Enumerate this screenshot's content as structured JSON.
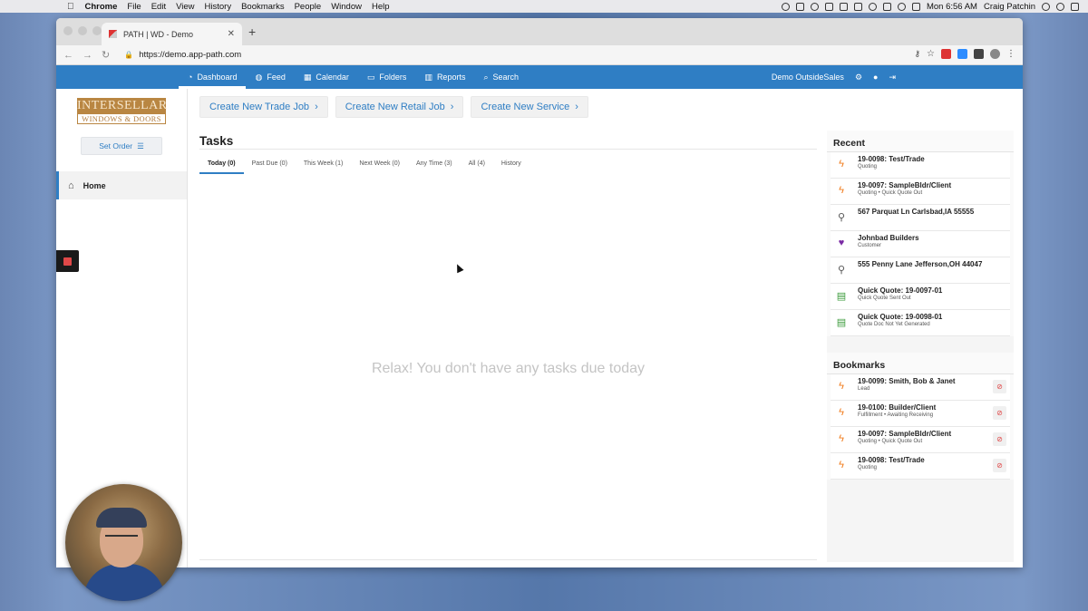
{
  "menubar": {
    "app": "Chrome",
    "items": [
      "File",
      "Edit",
      "View",
      "History",
      "Bookmarks",
      "People",
      "Window",
      "Help"
    ],
    "clock": "Mon 6:56 AM",
    "user": "Craig Patchin"
  },
  "browser": {
    "tab_title": "PATH | WD - Demo",
    "url": "https://demo.app-path.com"
  },
  "appnav": {
    "items": [
      {
        "label": "Dashboard",
        "icon": "dashboard-icon",
        "active": true
      },
      {
        "label": "Feed",
        "icon": "globe-icon"
      },
      {
        "label": "Calendar",
        "icon": "calendar-icon"
      },
      {
        "label": "Folders",
        "icon": "folder-icon"
      },
      {
        "label": "Reports",
        "icon": "bar-chart-icon"
      },
      {
        "label": "Search",
        "icon": "search-icon"
      }
    ],
    "account": "Demo OutsideSales"
  },
  "sidebar": {
    "logo_line1": "INTERSELLAR",
    "logo_line2": "WINDOWS & DOORS",
    "set_order": "Set Order",
    "home": "Home"
  },
  "quick_actions": [
    "Create New Trade Job",
    "Create New Retail Job",
    "Create New Service"
  ],
  "tasks": {
    "title": "Tasks",
    "tabs": [
      "Today (0)",
      "Past Due (0)",
      "This Week (1)",
      "Next Week (0)",
      "Any Time (3)",
      "All (4)",
      "History"
    ],
    "active_tab": "Today (0)",
    "empty_message": "Relax! You don't have any tasks due today"
  },
  "recent": {
    "title": "Recent",
    "items": [
      {
        "icon": "bolt-icon",
        "title": "19-0098: Test/Trade",
        "sub": "Quoting"
      },
      {
        "icon": "bolt-icon",
        "title": "19-0097: SampleBldr/Client",
        "sub": "Quoting • Quick Quote Out"
      },
      {
        "icon": "pin-icon",
        "title": "567 Parquat Ln Carlsbad,IA 55555",
        "sub": ""
      },
      {
        "icon": "heart-icon",
        "title": "Johnbad Builders",
        "sub": "Customer"
      },
      {
        "icon": "pin-icon",
        "title": "555 Penny Lane Jefferson,OH 44047",
        "sub": ""
      },
      {
        "icon": "document-icon",
        "title": "Quick Quote: 19-0097-01",
        "sub": "Quick Quote Sent Out"
      },
      {
        "icon": "document-icon",
        "title": "Quick Quote: 19-0098-01",
        "sub": "Quote Doc Not Yet Generated"
      }
    ]
  },
  "bookmarks": {
    "title": "Bookmarks",
    "items": [
      {
        "title": "19-0099: Smith, Bob & Janet",
        "sub": "Lead"
      },
      {
        "title": "19-0100: Builder/Client",
        "sub": "Fulfillment • Awaiting Receiving"
      },
      {
        "title": "19-0097: SampleBldr/Client",
        "sub": "Quoting • Quick Quote Out"
      },
      {
        "title": "19-0098: Test/Trade",
        "sub": "Quoting"
      }
    ]
  },
  "colors": {
    "accent": "#2f7ec4",
    "bolt": "#f07a1a",
    "remove": "#e04848"
  }
}
